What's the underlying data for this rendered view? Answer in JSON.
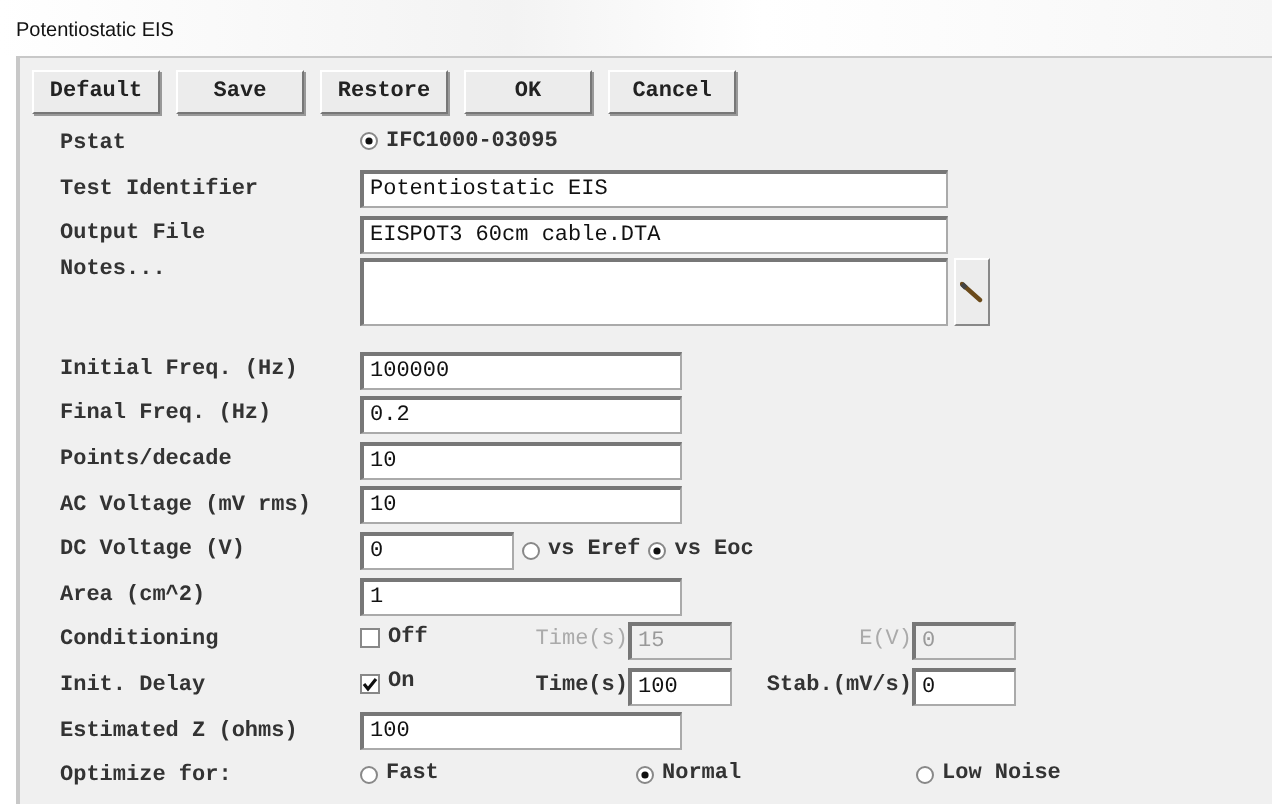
{
  "window": {
    "title": "Potentiostatic EIS"
  },
  "buttons": [
    "Default",
    "Save",
    "Restore",
    "OK",
    "Cancel"
  ],
  "rows": [
    {
      "kind": "radios",
      "label": "Pstat",
      "options": [
        {
          "label": "IFC1000-03095",
          "selected": true
        }
      ]
    },
    {
      "kind": "wide_field",
      "label": "Test Identifier",
      "value": "Potentiostatic EIS"
    },
    {
      "kind": "wide_field",
      "label": "Output File",
      "value": "EISPOT3 60cm cable.DTA"
    },
    {
      "kind": "notes",
      "label": "Notes..."
    },
    {
      "kind": "field",
      "label": "Initial Freq. (Hz)",
      "value": "100000"
    },
    {
      "kind": "field",
      "label": "Final Freq. (Hz)",
      "value": "0.2"
    },
    {
      "kind": "field",
      "label": "Points/decade",
      "value": "10"
    },
    {
      "kind": "field",
      "label": "AC Voltage (mV rms)",
      "value": "10"
    },
    {
      "kind": "field_radios",
      "label": "DC Voltage (V)",
      "value": "0",
      "options": [
        {
          "label": "vs Eref",
          "selected": false
        },
        {
          "label": "vs Eoc",
          "selected": true
        }
      ]
    },
    {
      "kind": "field",
      "label": "Area (cm^2)",
      "value": "1"
    },
    {
      "kind": "checkbox_fields",
      "label": "Conditioning",
      "checkbox": {
        "label": "Off",
        "checked": false
      },
      "fields": [
        {
          "label": "Time(s)",
          "value": "15"
        },
        {
          "label": "E(V)",
          "value": "0"
        }
      ]
    },
    {
      "kind": "checkbox_fields",
      "label": "Init. Delay",
      "checkbox": {
        "label": "On",
        "checked": true
      },
      "fields": [
        {
          "label": "Time(s)",
          "value": "100"
        },
        {
          "label": "Stab.(mV/s)",
          "value": "0"
        }
      ]
    },
    {
      "kind": "field",
      "label": "Estimated Z (ohms)",
      "value": "100"
    },
    {
      "kind": "radios",
      "label": "Optimize for:",
      "options": [
        {
          "label": "Fast",
          "selected": false
        },
        {
          "label": "Normal",
          "selected": true
        },
        {
          "label": "Low Noise",
          "selected": false
        }
      ]
    }
  ]
}
